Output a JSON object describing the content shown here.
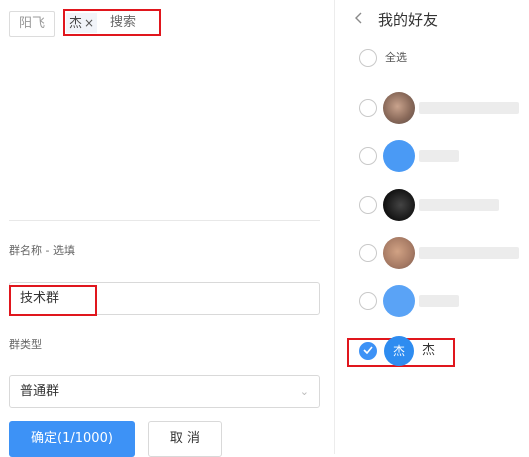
{
  "left": {
    "selected_chips": [
      "阳飞",
      "杰"
    ],
    "remove_glyph": "×",
    "search_placeholder": "搜索",
    "group_name_label": "群名称 - 选填",
    "group_name_value": "技术群",
    "group_type_label": "群类型",
    "group_type_value": "普通群",
    "confirm_label": "确定(1/1000)",
    "cancel_label": "取 消"
  },
  "right": {
    "title": "我的好友",
    "select_all_label": "全选",
    "friends": [
      {
        "name": "",
        "initial": "",
        "checked": false
      },
      {
        "name": "",
        "initial": "",
        "checked": false
      },
      {
        "name": "",
        "initial": "",
        "checked": false
      },
      {
        "name": "",
        "initial": "",
        "checked": false
      },
      {
        "name": "",
        "initial": "",
        "checked": false
      },
      {
        "name": "杰",
        "initial": "杰",
        "checked": true
      }
    ]
  },
  "colors": {
    "accent": "#3d92f6",
    "highlight_box": "#e0161d"
  },
  "icons": {
    "back": "chevron-left-icon",
    "select_arrow": "chevron-down-icon",
    "check": "check-icon"
  }
}
